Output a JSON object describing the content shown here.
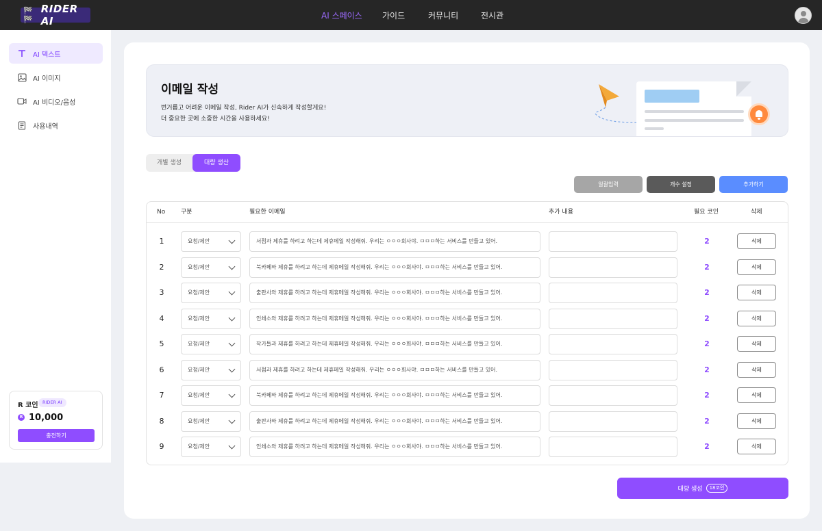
{
  "header": {
    "brand": "RIDER AI",
    "nav": [
      "AI 스페이스",
      "가이드",
      "커뮤니티",
      "전시관"
    ],
    "active_nav": "AI 스페이스"
  },
  "sidebar": {
    "items": [
      {
        "label": "AI 텍스트",
        "icon": "text-icon",
        "active": true
      },
      {
        "label": "AI 이미지",
        "icon": "image-icon",
        "active": false
      },
      {
        "label": "AI 비디오/음성",
        "icon": "video-icon",
        "active": false
      },
      {
        "label": "사용내역",
        "icon": "document-icon",
        "active": false
      }
    ],
    "coin": {
      "title": "R 코인",
      "badge": "RIDER AI",
      "coin_symbol": "R",
      "amount": "10,000",
      "charge_label": "충전하기"
    }
  },
  "banner": {
    "title": "이메일 작성",
    "line1": "번거롭고 어려운 이메일 작성, Rider AI가 신속하게 작성할게요!",
    "line2": "더 중요한 곳에 소중한 시간을 사용하세요!"
  },
  "tabs": {
    "single": "개별 생성",
    "bulk": "대량 생산"
  },
  "actions": {
    "bulk_input": "일괄입력",
    "set_count": "개수 설정",
    "add": "추가하기"
  },
  "table": {
    "headers": {
      "no": "No",
      "category": "구분",
      "email": "필요한 이메일",
      "extra": "추가 내용",
      "coin": "필요 코인",
      "delete": "삭제"
    },
    "rows": [
      {
        "no": "1",
        "category": "요청/제안",
        "email": "서점과 제휴를 하려고 하는데 제휴메일 작성해줘. 우리는 ㅇㅇㅇ회사야. ㅁㅁㅁ하는 서비스를 만들고 있어.",
        "coin": "2",
        "delete": "삭제"
      },
      {
        "no": "2",
        "category": "요청/제안",
        "email": "북카페와 제휴를 하려고 하는데 제휴메일 작성해줘. 우리는 ㅇㅇㅇ회사야. ㅁㅁㅁ하는 서비스를 만들고 있어.",
        "coin": "2",
        "delete": "삭제"
      },
      {
        "no": "3",
        "category": "요청/제안",
        "email": "출판사와 제휴를 하려고 하는데 제휴메일 작성해줘. 우리는 ㅇㅇㅇ회사야. ㅁㅁㅁ하는 서비스를 만들고 있어.",
        "coin": "2",
        "delete": "삭제"
      },
      {
        "no": "4",
        "category": "요청/제안",
        "email": "인쇄소와 제휴를 하려고 하는데 제휴메일 작성해줘. 우리는 ㅇㅇㅇ회사야. ㅁㅁㅁ하는 서비스를 만들고 있어.",
        "coin": "2",
        "delete": "삭제"
      },
      {
        "no": "5",
        "category": "요청/제안",
        "email": "작가들과 제휴를 하려고 하는데 제휴메일 작성해줘. 우리는 ㅇㅇㅇ회사야. ㅁㅁㅁ하는 서비스를 만들고 있어.",
        "coin": "2",
        "delete": "삭제"
      },
      {
        "no": "6",
        "category": "요청/제안",
        "email": "서점과 제휴를 하려고 하는데 제휴메일 작성해줘. 우리는 ㅇㅇㅇ회사야. ㅁㅁㅁ하는 서비스를 만들고 있어.",
        "coin": "2",
        "delete": "삭제"
      },
      {
        "no": "7",
        "category": "요청/제안",
        "email": "북카페와 제휴를 하려고 하는데 제휴메일 작성해줘. 우리는 ㅇㅇㅇ회사야. ㅁㅁㅁ하는 서비스를 만들고 있어.",
        "coin": "2",
        "delete": "삭제"
      },
      {
        "no": "8",
        "category": "요청/제안",
        "email": "출판사와 제휴를 하려고 하는데 제휴메일 작성해줘. 우리는 ㅇㅇㅇ회사야. ㅁㅁㅁ하는 서비스를 만들고 있어.",
        "coin": "2",
        "delete": "삭제"
      },
      {
        "no": "9",
        "category": "요청/제안",
        "email": "인쇄소와 제휴를 하려고 하는데 제휴메일 작성해줘. 우리는 ㅇㅇㅇ회사야. ㅁㅁㅁ하는 서비스를 만들고 있어.",
        "coin": "2",
        "delete": "삭제"
      }
    ]
  },
  "mass_generate": {
    "label": "대량 생성",
    "cost": "18코인"
  },
  "colors": {
    "accent": "#8f4dff",
    "topbar": "#262626",
    "blue_button": "#5a8dff",
    "gray_button": "#a6a6a6",
    "dark_button": "#5a5a5a"
  }
}
